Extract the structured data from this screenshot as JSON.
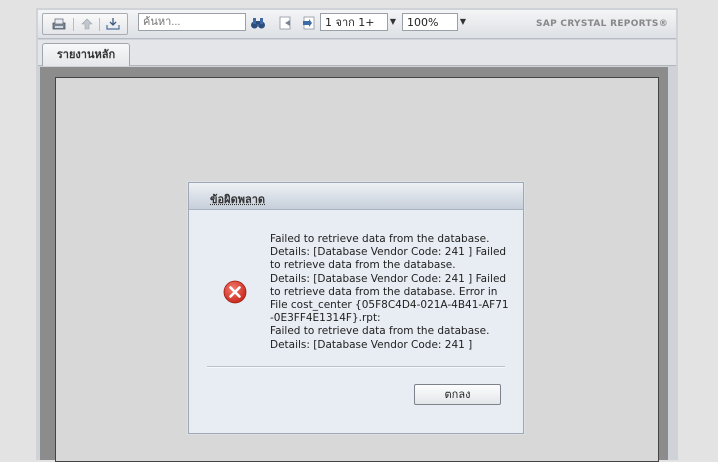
{
  "toolbar": {
    "search": {
      "placeholder": "ค้นหา..."
    },
    "page_nav": {
      "value": "1 จาก 1+"
    },
    "zoom": {
      "value": "100%"
    },
    "brand": "SAP CRYSTAL REPORTS®",
    "icons": [
      "export-icon",
      "up-arrow-icon",
      "print-icon",
      "binoculars-icon",
      "prev-page-icon",
      "next-page-icon"
    ]
  },
  "tabs": [
    {
      "label": "รายงานหลัก",
      "active": true
    }
  ],
  "dialog": {
    "title": "ข้อผิดพลาด",
    "message_lines": [
      "Failed to retrieve data from the database.",
      "Details: [Database Vendor Code: 241 ] Failed",
      "to retrieve data from the database.",
      "Details: [Database Vendor Code: 241 ] Failed",
      "to retrieve data from the database. Error in",
      "File cost_center {05F8C4D4-021A-4B41-AF71",
      "-0E3FF4E1314F}.rpt:",
      "Failed to retrieve data from the database.",
      "Details: [Database Vendor Code: 241 ]"
    ],
    "ok_label": "ตกลง",
    "icon": "error-icon"
  },
  "colors": {
    "error_red": "#d83a2e",
    "dialog_bg": "#e8ecf3",
    "viewer_gray": "#8c8c8c"
  }
}
